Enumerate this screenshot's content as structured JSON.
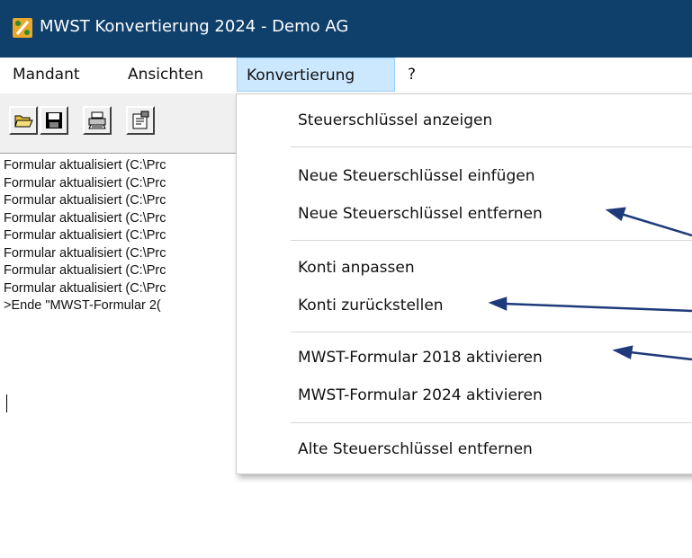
{
  "window": {
    "title": "MWST Konvertierung 2024 - Demo AG",
    "icon": "app-percent-icon",
    "titlebar_color": "#0f3f6b"
  },
  "menubar": {
    "items": [
      {
        "label": "Mandant"
      },
      {
        "label": "Ansichten"
      },
      {
        "label": "Konvertierung",
        "open": true
      },
      {
        "label": "?"
      }
    ]
  },
  "toolbar": {
    "buttons": [
      {
        "icon": "open-folder-icon"
      },
      {
        "icon": "save-disk-icon"
      },
      {
        "icon": "printer-icon"
      },
      {
        "icon": "properties-icon"
      }
    ]
  },
  "log": {
    "lines": [
      "Formular aktualisiert (C:\\Prc",
      "Formular aktualisiert (C:\\Prc",
      "Formular aktualisiert (C:\\Prc",
      "Formular aktualisiert (C:\\Prc",
      "Formular aktualisiert (C:\\Prc",
      "Formular aktualisiert (C:\\Prc",
      "Formular aktualisiert (C:\\Prc",
      "Formular aktualisiert (C:\\Prc",
      ">Ende \"MWST-Formular 2("
    ]
  },
  "dropdown": {
    "items": [
      {
        "label": "Steuerschlüssel anzeigen"
      },
      {
        "label": "Neue Steuerschlüssel einfügen"
      },
      {
        "label": "Neue Steuerschlüssel entfernen",
        "arrow": true
      },
      {
        "label": "Konti anpassen"
      },
      {
        "label": "Konti zurückstellen",
        "arrow": true
      },
      {
        "label": "MWST-Formular 2018 aktivieren",
        "arrow": true
      },
      {
        "label": "MWST-Formular 2024 aktivieren"
      },
      {
        "label": "Alte Steuerschlüssel entfernen"
      }
    ]
  },
  "colors": {
    "menu_highlight": "#cce8ff",
    "annotation_arrow": "#1f3a7a"
  }
}
